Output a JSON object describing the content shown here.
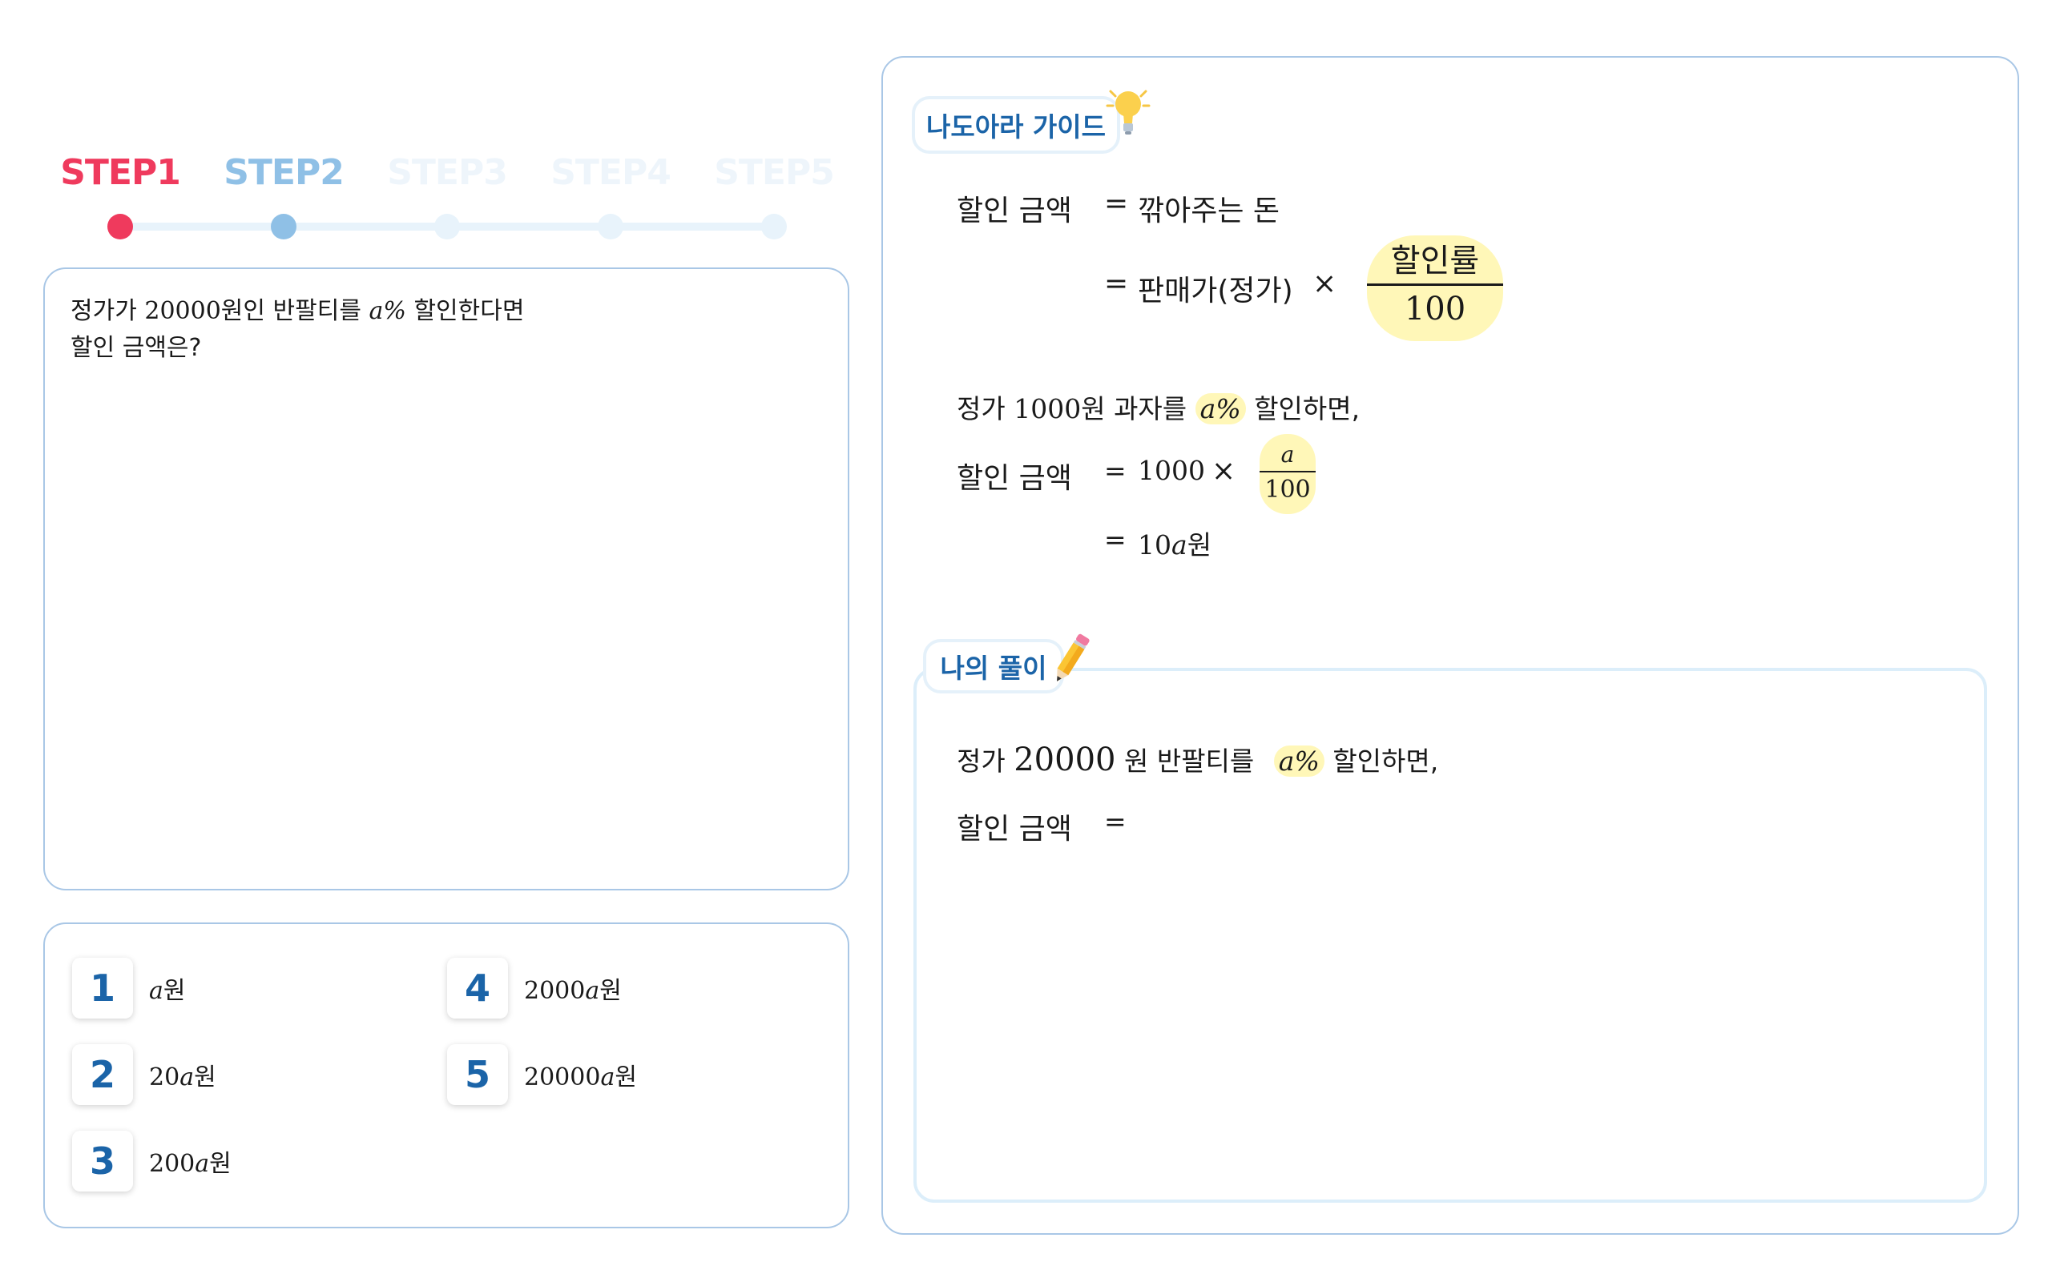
{
  "steps": [
    {
      "label": "STEP1",
      "state": "current",
      "color": "#ef3a5d"
    },
    {
      "label": "STEP2",
      "state": "next",
      "color": "#8fc0e6"
    },
    {
      "label": "STEP3",
      "state": "locked",
      "color": "#eef5fb"
    },
    {
      "label": "STEP4",
      "state": "locked",
      "color": "#eef5fb"
    },
    {
      "label": "STEP5",
      "state": "locked",
      "color": "#eef5fb"
    }
  ],
  "question": {
    "line1_a": "정가가",
    "line1_price": "20000",
    "line1_b": "원인  반팔티를",
    "line1_var": "a%",
    "line1_c": "할인한다면",
    "line2": "할인  금액은?"
  },
  "choices": [
    {
      "num": "1",
      "prefix": "",
      "var": "a",
      "unit": "원"
    },
    {
      "num": "2",
      "prefix": "20",
      "var": "a",
      "unit": "원"
    },
    {
      "num": "3",
      "prefix": "200",
      "var": "a",
      "unit": "원"
    },
    {
      "num": "4",
      "prefix": "2000",
      "var": "a",
      "unit": "원"
    },
    {
      "num": "5",
      "prefix": "20000",
      "var": "a",
      "unit": "원"
    }
  ],
  "guide": {
    "title": "나도아라 가이드",
    "def_left": "할인  금액",
    "eq": "=",
    "def_right1": "깎아주는  돈",
    "def_right2": "판매가(정가)",
    "times": "×",
    "frac_num": "할인률",
    "frac_den": "100",
    "ex_a": "정가",
    "ex_price": "1000",
    "ex_b": "원  과자를",
    "ex_var": "a%",
    "ex_c": "할인하면,",
    "ex_left": "할인  금액",
    "ex_val": "1000",
    "ex_frac_num": "a",
    "ex_frac_den": "100",
    "ex_result_num": "10",
    "ex_result_var": "a",
    "ex_result_unit": "원"
  },
  "solution": {
    "title": "나의 풀이",
    "line1_a": "정가",
    "line1_price": "20000",
    "line1_b": "원  반팔티를",
    "line1_var": "a%",
    "line1_c": "할인하면,",
    "line2": "할인  금액",
    "eq": "="
  }
}
